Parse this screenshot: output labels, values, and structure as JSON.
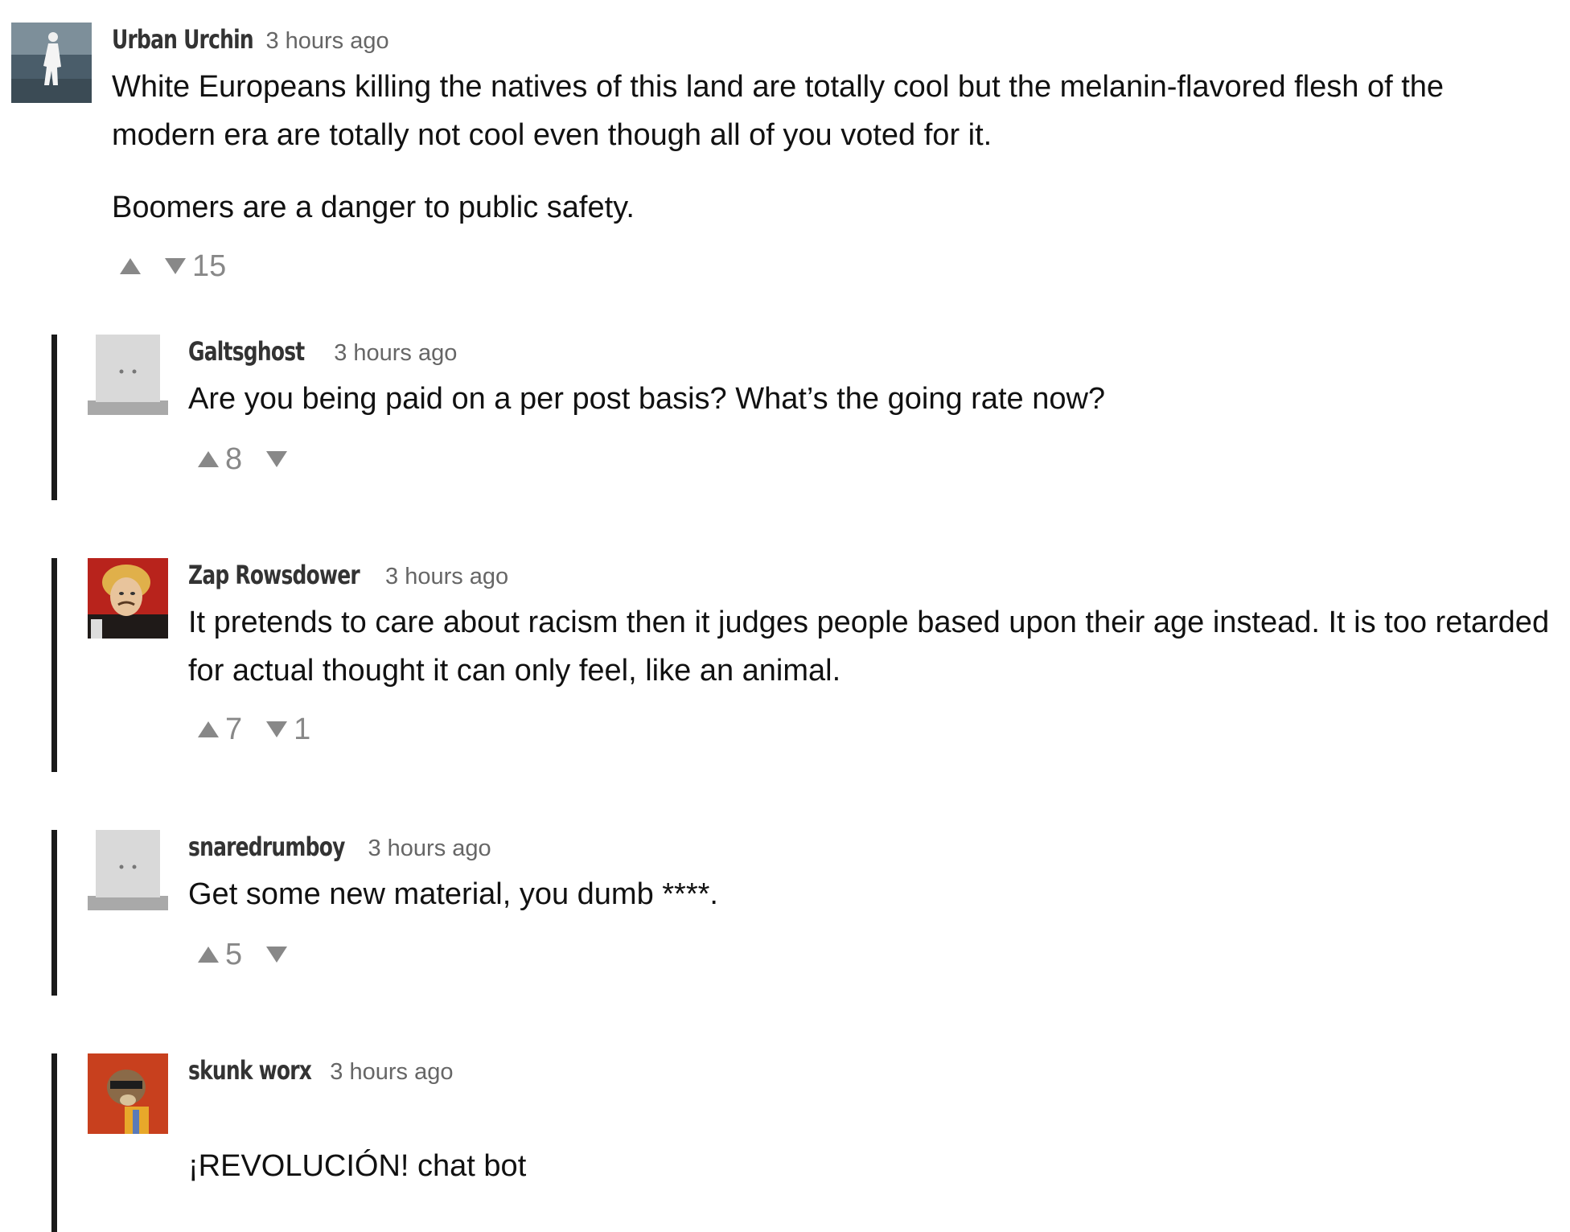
{
  "comments": [
    {
      "username": "Urban Urchin",
      "time": "3 hours ago",
      "paragraphs": [
        "White Europeans killing the natives of this land are totally cool but the melanin-flavored flesh of the modern era are totally not cool even though all of you voted for it.",
        "Boomers are a danger to public safety."
      ],
      "upvotes": "",
      "downvotes": "15"
    },
    {
      "username": "Galtsghost",
      "time": "3 hours ago",
      "paragraphs": [
        "Are you being paid on a per post basis?  What’s the going rate now?"
      ],
      "upvotes": "8",
      "downvotes": ""
    },
    {
      "username": "Zap Rowsdower",
      "time": "3 hours ago",
      "paragraphs": [
        "It pretends to care about racism then it judges people based upon their age instead. It is too retarded for actual thought it can only feel, like an animal."
      ],
      "upvotes": "7",
      "downvotes": "1"
    },
    {
      "username": "snaredrumboy",
      "time": "3 hours ago",
      "paragraphs": [
        "Get some new material, you dumb ****."
      ],
      "upvotes": "5",
      "downvotes": ""
    },
    {
      "username": "skunk worx",
      "time": "3 hours ago",
      "paragraphs": [
        "¡REVOLUCIÓN! chat bot"
      ],
      "upvotes": "",
      "downvotes": ""
    }
  ],
  "icons": {
    "upvote": "triangle-up-icon",
    "downvote": "triangle-down-icon"
  },
  "colors": {
    "reply_rule": "#1a1a1a",
    "vote_gray": "#888888",
    "username": "#333333",
    "timestamp": "#666666"
  }
}
